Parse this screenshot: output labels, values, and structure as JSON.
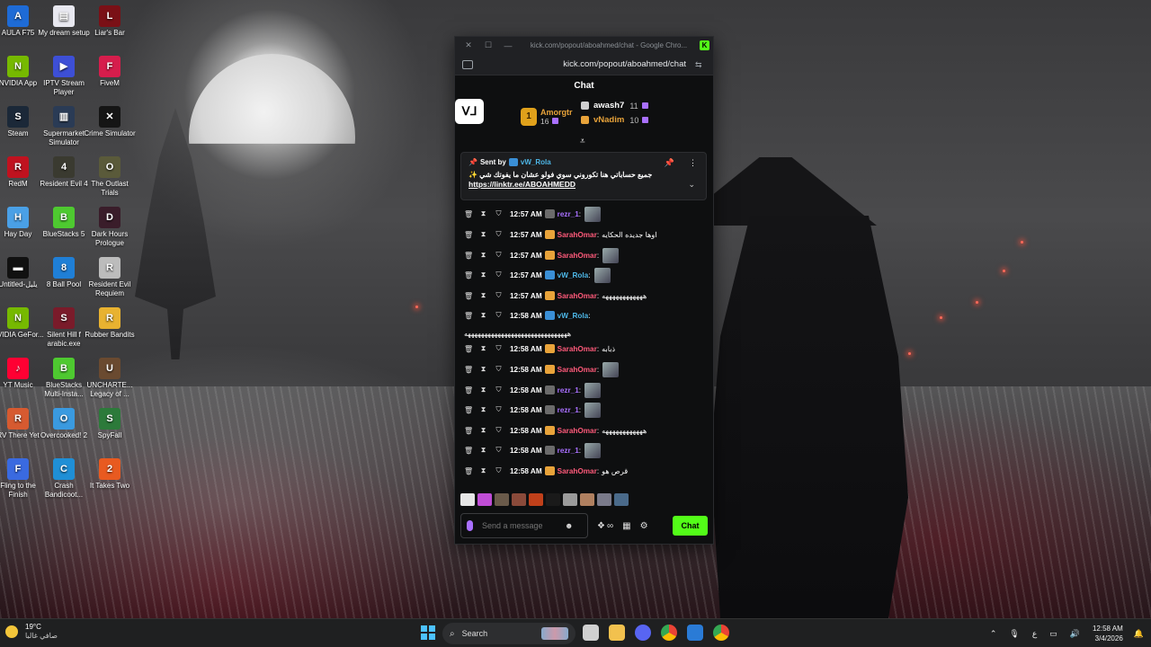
{
  "desktop_icons": [
    {
      "label": "AULA F75",
      "color": "#1e6bd6",
      "glyph": "A"
    },
    {
      "label": "My dream setup",
      "color": "#e8e8f0",
      "glyph": "▤"
    },
    {
      "label": "Liar's Bar",
      "color": "#7a1016",
      "glyph": "L"
    },
    {
      "label": "NVIDIA App",
      "color": "#76b900",
      "glyph": "N"
    },
    {
      "label": "IPTV Stream Player",
      "color": "#3d4fd6",
      "glyph": "▶"
    },
    {
      "label": "FiveM",
      "color": "#d61d4c",
      "glyph": "F"
    },
    {
      "label": "Steam",
      "color": "#1b2838",
      "glyph": "S"
    },
    {
      "label": "Supermarket Simulator",
      "color": "#2a3b55",
      "glyph": "▥"
    },
    {
      "label": "Crime Simulator",
      "color": "#151515",
      "glyph": "✕"
    },
    {
      "label": "RedM",
      "color": "#c0121f",
      "glyph": "R"
    },
    {
      "label": "Resident Evil 4",
      "color": "#3a3a30",
      "glyph": "4"
    },
    {
      "label": "The Outlast Trials",
      "color": "#5a5a3a",
      "glyph": "O"
    },
    {
      "label": "Hay Day",
      "color": "#4aa0e6",
      "glyph": "H"
    },
    {
      "label": "BlueStacks 5",
      "color": "#4ec930",
      "glyph": "B"
    },
    {
      "label": "Dark Hours Prologue",
      "color": "#3a1d2a",
      "glyph": "D"
    },
    {
      "label": "Untitled-يليل",
      "color": "#111111",
      "glyph": "▬"
    },
    {
      "label": "8 Ball Pool",
      "color": "#1f7fd6",
      "glyph": "8"
    },
    {
      "label": "Resident Evil Requiem",
      "color": "#bcbcbc",
      "glyph": "R"
    },
    {
      "label": "NVIDIA GeFor...",
      "color": "#76b900",
      "glyph": "N"
    },
    {
      "label": "Silent Hill f arabic.exe",
      "color": "#7a1b2a",
      "glyph": "S"
    },
    {
      "label": "Rubber Bandits",
      "color": "#e8b230",
      "glyph": "R"
    },
    {
      "label": "YT Music",
      "color": "#ff0033",
      "glyph": "♪"
    },
    {
      "label": "BlueStacks Multi-Insta...",
      "color": "#4ec930",
      "glyph": "B"
    },
    {
      "label": "UNCHARTE... Legacy of ...",
      "color": "#6a4a30",
      "glyph": "U"
    },
    {
      "label": "RV There Yet",
      "color": "#d65a30",
      "glyph": "R"
    },
    {
      "label": "Overcooked! 2",
      "color": "#3a9ae0",
      "glyph": "O"
    },
    {
      "label": "SpyFall",
      "color": "#2c7a3a",
      "glyph": "S"
    },
    {
      "label": "Fling to the Finish",
      "color": "#3a6ae0",
      "glyph": "F"
    },
    {
      "label": "Crash Bandicoot...",
      "color": "#1f8fd6",
      "glyph": "C"
    },
    {
      "label": "It Takes Two",
      "color": "#e85a20",
      "glyph": "2"
    }
  ],
  "browser": {
    "title": "kick.com/popout/aboahmed/chat - Google Chro...",
    "url": "kick.com/popout/aboahmed/chat"
  },
  "chat": {
    "header": "Chat",
    "logo_text": "ᐯᒧ",
    "leaderboard": {
      "first": {
        "rank": "1",
        "name": "Amorgtr",
        "count": "16"
      },
      "others": [
        {
          "name": "awash7",
          "count": "11",
          "name_color": "#ffffff",
          "icon_color": "#cfcfcf"
        },
        {
          "name": "vNadim",
          "count": "10",
          "name_color": "#e8a33a",
          "icon_color": "#e8a33a"
        }
      ]
    },
    "pinned": {
      "sent_label": "Sent by",
      "sender": "vW_Rola",
      "message": "جميع حساباتي هنا تكوروني سوي فولو عشان ما يفوتك شي ✨",
      "link": "https://linktr.ee/ABOAHMEDD"
    },
    "messages": [
      {
        "time": "12:57 AM",
        "user": "rezr_1",
        "user_color": "#a970ff",
        "badge_color": "#6b6b6b",
        "text": "",
        "emote": true
      },
      {
        "time": "12:57 AM",
        "user": "SarahOmar",
        "user_color": "#ff5a7a",
        "badge_color": "#e8a33a",
        "text": "اوها جديده الحكايه",
        "emote": false
      },
      {
        "time": "12:57 AM",
        "user": "SarahOmar",
        "user_color": "#ff5a7a",
        "badge_color": "#e8a33a",
        "text": "",
        "emote": true
      },
      {
        "time": "12:57 AM",
        "user": "vW_Rola",
        "user_color": "#4db6e6",
        "badge_color": "#3a8fd6",
        "text": "",
        "emote": true
      },
      {
        "time": "12:57 AM",
        "user": "SarahOmar",
        "user_color": "#ff5a7a",
        "badge_color": "#e8a33a",
        "text": "ههههههههههههه",
        "emote": false
      },
      {
        "time": "12:58 AM",
        "user": "vW_Rola",
        "user_color": "#4db6e6",
        "badge_color": "#3a8fd6",
        "text": "",
        "emote": false
      },
      {
        "time": "12:58 AM",
        "user": "SarahOmar",
        "user_color": "#ff5a7a",
        "badge_color": "#e8a33a",
        "text": "ذبابه",
        "emote": false
      },
      {
        "time": "12:58 AM",
        "user": "SarahOmar",
        "user_color": "#ff5a7a",
        "badge_color": "#e8a33a",
        "text": "",
        "emote": true
      },
      {
        "time": "12:58 AM",
        "user": "rezr_1",
        "user_color": "#a970ff",
        "badge_color": "#6b6b6b",
        "text": "",
        "emote": true
      },
      {
        "time": "12:58 AM",
        "user": "rezr_1",
        "user_color": "#a970ff",
        "badge_color": "#6b6b6b",
        "text": "",
        "emote": true
      },
      {
        "time": "12:58 AM",
        "user": "SarahOmar",
        "user_color": "#ff5a7a",
        "badge_color": "#e8a33a",
        "text": "ههههههههههههه",
        "emote": false
      },
      {
        "time": "12:58 AM",
        "user": "rezr_1",
        "user_color": "#a970ff",
        "badge_color": "#6b6b6b",
        "text": "",
        "emote": true
      },
      {
        "time": "12:58 AM",
        "user": "SarahOmar",
        "user_color": "#ff5a7a",
        "badge_color": "#e8a33a",
        "text": "قرص هو",
        "emote": false
      }
    ],
    "wrapped_text": "هههههههههههههههههههههههههههههههه",
    "emote_bar_colors": [
      "#e6e6e6",
      "#c04dd6",
      "#6a5a4a",
      "#8a4a3a",
      "#c0401a",
      "#1a1a1a",
      "#9a9a9a",
      "#b08060",
      "#7a7a8a",
      "#4a6a8a"
    ],
    "input_placeholder": "Send a message",
    "send_label": "Chat",
    "brand_color": "#53fc18"
  },
  "taskbar": {
    "temperature": "19°C",
    "condition": "صافي غالبا",
    "search_label": "Search",
    "time": "12:58 AM",
    "date": "3/4/2026",
    "lang": "ع"
  }
}
